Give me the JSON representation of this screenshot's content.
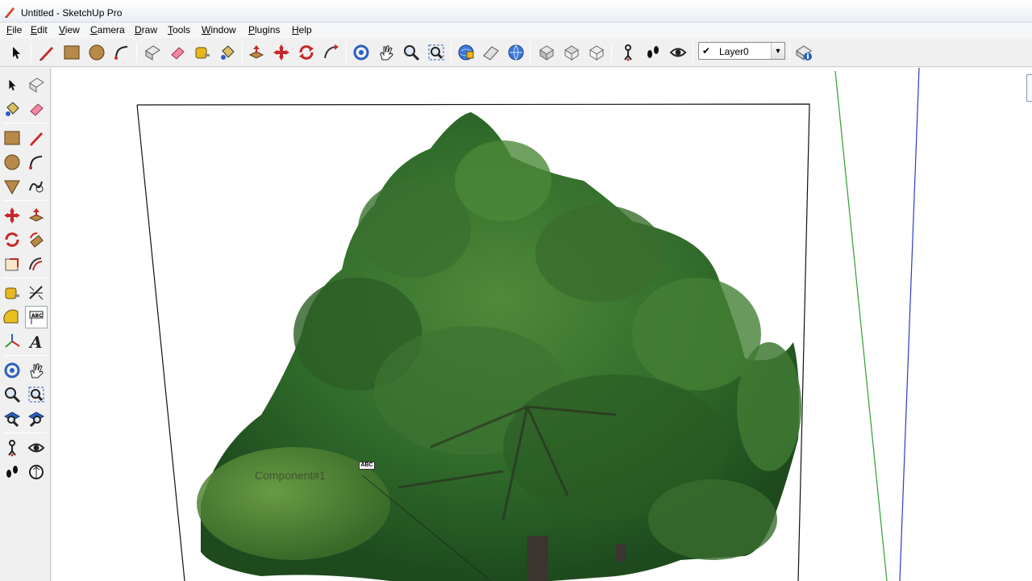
{
  "window": {
    "title": "Untitled - SketchUp Pro"
  },
  "menu": {
    "items": [
      {
        "label": "File",
        "u": "F",
        "rest": "ile"
      },
      {
        "label": "Edit",
        "u": "E",
        "rest": "dit"
      },
      {
        "label": "View",
        "u": "V",
        "rest": "iew"
      },
      {
        "label": "Camera",
        "u": "C",
        "rest": "amera"
      },
      {
        "label": "Draw",
        "u": "D",
        "rest": "raw"
      },
      {
        "label": "Tools",
        "u": "T",
        "rest": "ools"
      },
      {
        "label": "Window",
        "u": "W",
        "rest": "indow"
      },
      {
        "label": "Plugins",
        "u": "P",
        "rest": "lugins"
      },
      {
        "label": "Help",
        "u": "H",
        "rest": "elp"
      }
    ]
  },
  "layers": {
    "current": "Layer0",
    "check": "✔"
  },
  "canvas": {
    "component_label": "Component#1",
    "text_tag": "ABC",
    "axis_colors": {
      "green": "#2ea02e",
      "blue": "#2d3cc8"
    }
  },
  "icons": {
    "toolbar": [
      "select-arrow-icon",
      "pencil-line-icon",
      "rectangle-icon",
      "circle-icon",
      "arc-icon",
      "make-component-icon",
      "eraser-icon",
      "tape-measure-icon",
      "paint-bucket-icon",
      "push-pull-icon",
      "move-icon",
      "rotate-icon",
      "follow-me-icon",
      "orbit-icon",
      "pan-hand-icon",
      "zoom-icon",
      "zoom-extents-icon",
      "get-models-icon",
      "share-model-icon",
      "warehouse-icon",
      "iso-view-icon",
      "top-view-icon",
      "front-view-icon",
      "position-camera-icon",
      "walk-icon",
      "look-around-icon",
      "model-info-icon"
    ],
    "left": [
      "select-arrow-icon",
      "make-component-icon",
      "paint-bucket-icon",
      "eraser-icon",
      "rectangle-icon",
      "pencil-line-icon",
      "circle-icon",
      "arc-icon",
      "polygon-icon",
      "freehand-icon",
      "move-icon",
      "push-pull-icon",
      "rotate-icon",
      "follow-me-icon",
      "scale-icon",
      "offset-icon",
      "tape-measure-icon",
      "dimension-icon",
      "protractor-icon",
      "text-icon",
      "axes-icon",
      "3d-text-icon",
      "orbit-icon",
      "pan-hand-icon",
      "zoom-icon",
      "zoom-window-icon",
      "zoom-extents-icon",
      "previous-view-icon",
      "position-camera-icon",
      "look-around-icon",
      "walk-icon",
      "section-plane-icon"
    ]
  }
}
